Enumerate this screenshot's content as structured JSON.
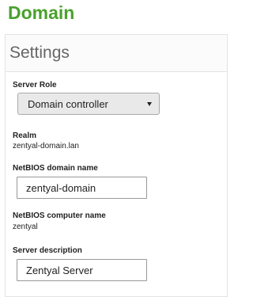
{
  "page": {
    "title": "Domain"
  },
  "panel": {
    "title": "Settings"
  },
  "server_role": {
    "label": "Server Role",
    "selected": "Domain controller"
  },
  "realm": {
    "label": "Realm",
    "value": "zentyal-domain.lan"
  },
  "netbios_domain": {
    "label": "NetBIOS domain name",
    "value": "zentyal-domain"
  },
  "netbios_computer": {
    "label": "NetBIOS computer name",
    "value": "zentyal"
  },
  "server_description": {
    "label": "Server description",
    "value": "Zentyal Server"
  },
  "colors": {
    "title_green": "#4aa12c",
    "select_background": "#e9e9e9",
    "panel_border": "#e3e3e3"
  }
}
